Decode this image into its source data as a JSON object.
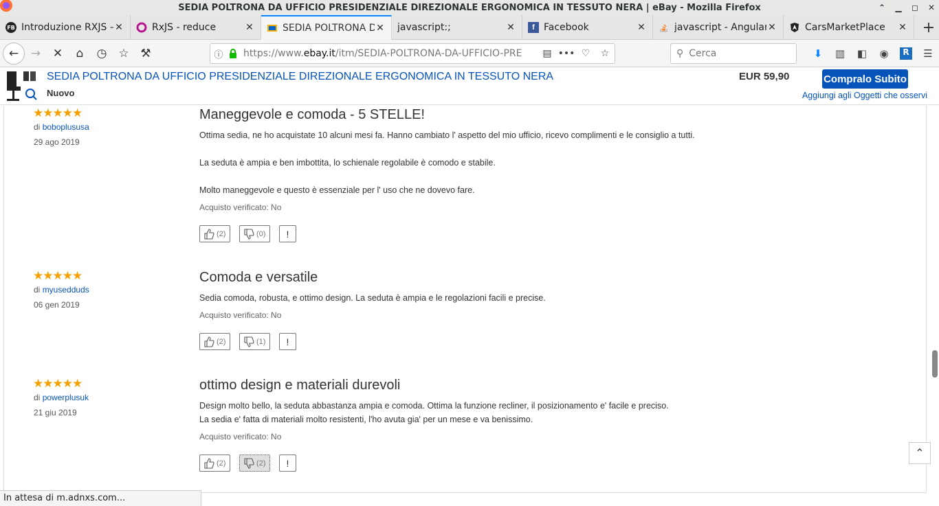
{
  "window": {
    "title": "SEDIA POLTRONA DA UFFICIO PRESIDENZIALE DIREZIONALE ERGONOMICA IN TESSUTO NERA | eBay - Mozilla Firefox"
  },
  "tabs": [
    {
      "label": "Introduzione RXJS –",
      "icon": "fb-icon"
    },
    {
      "label": "RxJS - reduce",
      "icon": "rxjs-icon"
    },
    {
      "label": "SEDIA POLTRONA DA",
      "icon": "ebay-icon",
      "active": true
    },
    {
      "label": "javascript:;",
      "icon": ""
    },
    {
      "label": "Facebook",
      "icon": "facebook-icon"
    },
    {
      "label": "javascript - Angular",
      "icon": "stackoverflow-icon"
    },
    {
      "label": "CarsMarketPlace",
      "icon": "angular-icon"
    }
  ],
  "nav": {
    "url_prefix": "https://www.",
    "url_domain": "ebay.it",
    "url_rest": "/itm/SEDIA-POLTRONA-DA-UFFICIO-PRE",
    "search_placeholder": "Cerca"
  },
  "product": {
    "title": "SEDIA POLTRONA DA UFFICIO PRESIDENZIALE DIREZIONALE ERGONOMICA IN TESSUTO NERA",
    "condition": "Nuovo",
    "price": "EUR 59,90",
    "buy_label": "Compralo Subito",
    "watch_label": "Aggiungi agli Oggetti che osservi"
  },
  "reviews": [
    {
      "stars": "★★★★★",
      "by_prefix": "di",
      "author": "boboplususa",
      "date": "29 ago 2019",
      "title": "Maneggevole e comoda - 5 STELLE!",
      "body": [
        "Ottima sedia, ne ho acquistate 10 alcuni mesi fa. Hanno cambiato l' aspetto del mio ufficio, ricevo complimenti e le consiglio a tutti.",
        "La seduta è ampia e ben imbottita, lo schienale regolabile è comodo e stabile.",
        "Molto maneggevole e questo è essenziale per l' uso che ne dovevo fare."
      ],
      "verified": "Acquisto verificato: No",
      "up": "(2)",
      "down": "(0)",
      "flag": "!"
    },
    {
      "stars": "★★★★★",
      "by_prefix": "di",
      "author": "myusedduds",
      "date": "06 gen 2019",
      "title": "Comoda e versatile",
      "body": [
        "Sedia comoda, robusta, e ottimo design. La seduta è ampia e le regolazioni facili e precise."
      ],
      "verified": "Acquisto verificato: No",
      "up": "(2)",
      "down": "(1)",
      "flag": "!"
    },
    {
      "stars": "★★★★★",
      "by_prefix": "di",
      "author": "powerplusuk",
      "date": "21 giu 2019",
      "title": "ottimo design e materiali durevoli",
      "body": [
        "Design molto bello, la seduta abbastanza ampia e comoda. Ottima la funzione recliner, il posizionamento e' facile e preciso.",
        "La sedia e' fatta di materiali molto resistenti, l'ho avuta gia' per un mese e va benissimo."
      ],
      "verified": "Acquisto verificato: No",
      "up": "(2)",
      "down": "(2)",
      "flag": "!"
    }
  ],
  "status": {
    "text": "In attesa di m.adnxs.com..."
  }
}
